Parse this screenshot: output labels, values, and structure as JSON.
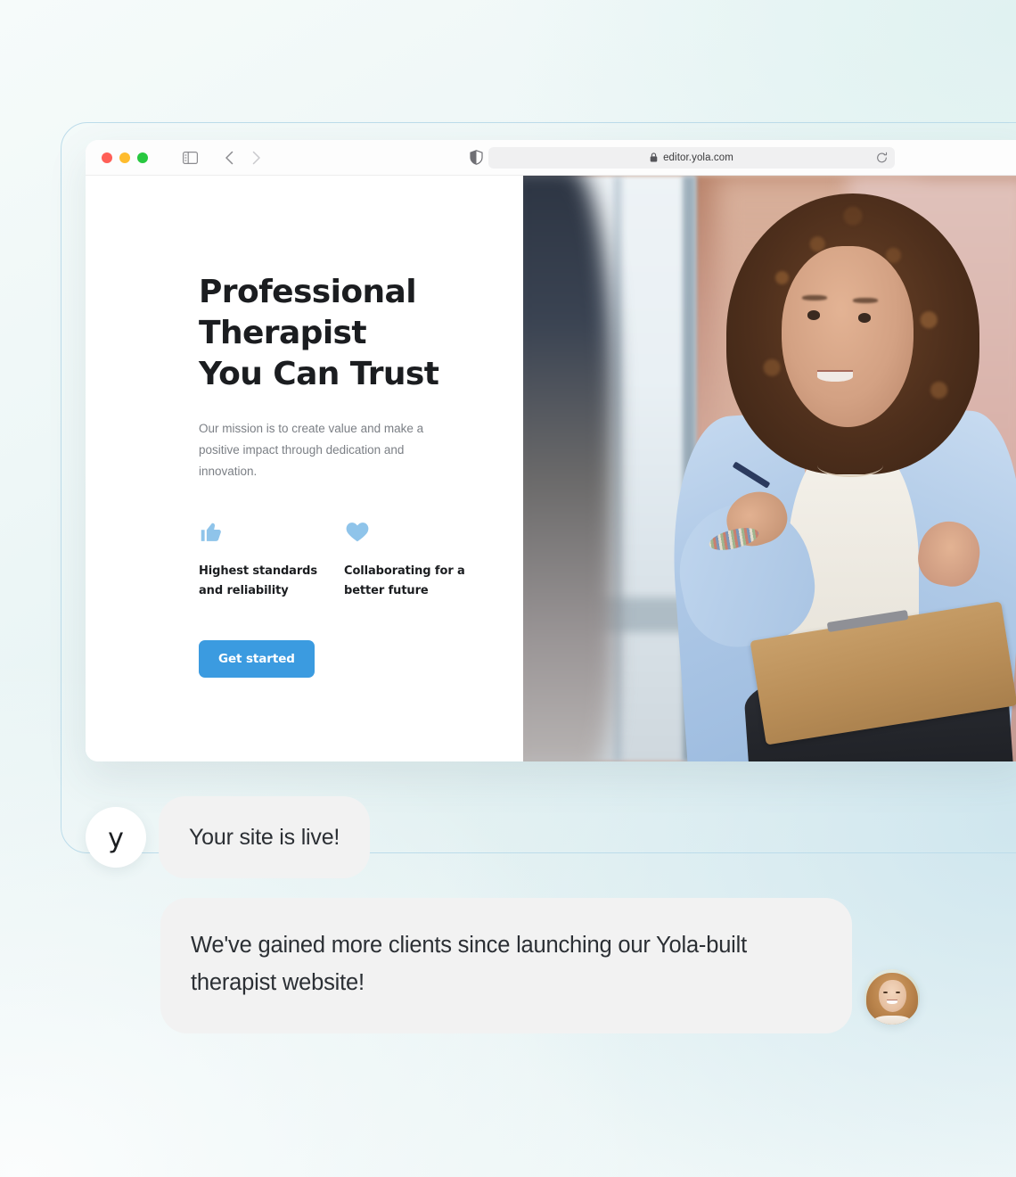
{
  "browser": {
    "url": "editor.yola.com",
    "icons": {
      "sidebar": "sidebar-toggle-icon",
      "back": "chevron-left-icon",
      "forward": "chevron-right-icon",
      "shield": "shield-icon",
      "lock": "lock-icon",
      "reload": "reload-icon"
    },
    "traffic_lights": {
      "close": "#ff5f57",
      "minimize": "#febc2e",
      "maximize": "#28c840"
    }
  },
  "site": {
    "hero_title": "Professional Therapist You Can Trust",
    "hero_subtitle": "Our mission is to create value and make a positive impact through dedication and innovation.",
    "features": [
      {
        "icon": "thumbs-up-icon",
        "label": "Highest standards and reliability"
      },
      {
        "icon": "heart-icon",
        "label": "Collaborating for a better future"
      }
    ],
    "cta_label": "Get started",
    "photo_alt": "Therapist in light blue cardigan holding a clipboard",
    "colors": {
      "accent": "#3b9be0",
      "feature_icon": "#8fc4ea",
      "heading": "#1b1d20",
      "body_text": "#7b7f85"
    }
  },
  "chat": {
    "logo_letter": "y",
    "messages": [
      {
        "id": "site-live",
        "text": "Your site is live!"
      },
      {
        "id": "testimonial",
        "text": "We've gained more clients since launching our Yola-built therapist website!"
      }
    ],
    "bubble_color": "#f2f2f2"
  },
  "background": {
    "top_right": "#e2f3f2",
    "right": "#d2e8ee",
    "bottom_left": "#fbfdfd",
    "frame_border": "#bcdcea"
  }
}
